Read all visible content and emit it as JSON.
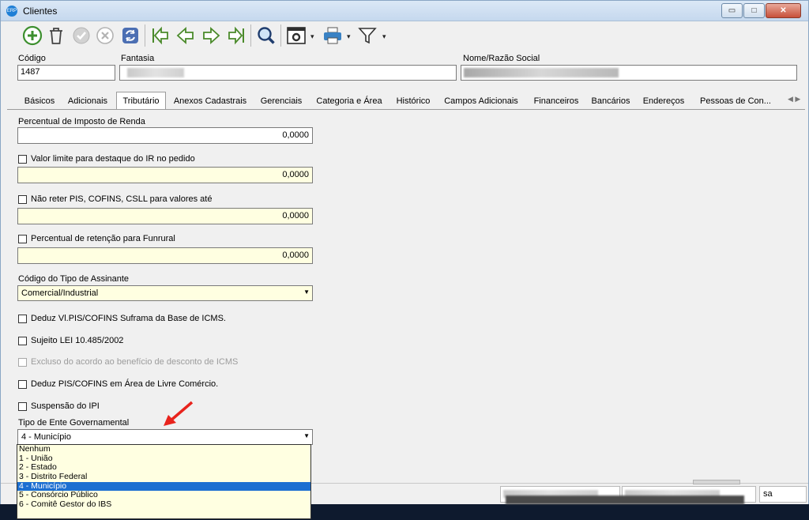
{
  "window": {
    "title": "Clientes",
    "app_icon_text": "ERP",
    "controls": {
      "minimize": "▭",
      "maximize": "□",
      "close": "✕"
    }
  },
  "toolbar": {
    "icons": [
      "add-icon",
      "delete-icon",
      "confirm-icon",
      "cancel-icon",
      "refresh-icon",
      "first-record-icon",
      "previous-record-icon",
      "next-record-icon",
      "last-record-icon",
      "search-icon",
      "settings-icon",
      "print-icon",
      "filter-icon"
    ],
    "dropdown_marker": "▾"
  },
  "header": {
    "codigo_label": "Código",
    "codigo_value": "1487",
    "fantasia_label": "Fantasia",
    "nome_label": "Nome/Razão Social"
  },
  "tabs": {
    "items": [
      "Básicos",
      "Adicionais",
      "Tributário",
      "Anexos Cadastrais",
      "Gerenciais",
      "Categoria e Área",
      "Histórico",
      "Campos Adicionais",
      "Financeiros",
      "Bancários",
      "Endereços",
      "Pessoas de Con..."
    ],
    "active": "Tributário",
    "scroll_arrows": "◀ ▶"
  },
  "tributario": {
    "ir_label": "Percentual de Imposto de Renda",
    "ir_value": "0,0000",
    "limite_ir_label": "Valor limite para destaque do IR no pedido",
    "limite_ir_value": "0,0000",
    "nao_reter_label": "Não reter PIS, COFINS, CSLL para valores até",
    "nao_reter_value": "0,0000",
    "funrural_label": "Percentual de retenção para Funrural",
    "funrural_value": "0,0000",
    "assinante_label": "Código do Tipo de Assinante",
    "assinante_value": "Comercial/Industrial",
    "checkboxes": [
      {
        "label": "Deduz Vl.PIS/COFINS Suframa da Base de ICMS.",
        "disabled": false
      },
      {
        "label": "Sujeito LEI 10.485/2002",
        "disabled": false
      },
      {
        "label": "Excluso do acordo ao benefício de desconto de ICMS",
        "disabled": true
      },
      {
        "label": "Deduz PIS/COFINS em Área de Livre Comércio.",
        "disabled": false
      },
      {
        "label": "Suspensão do IPI",
        "disabled": false
      }
    ],
    "ente_label": "Tipo de Ente Governamental",
    "ente_value": "4 - Município",
    "ente_options": [
      "Nenhum",
      "1 - União",
      "2 - Estado",
      "3 - Distrito Federal",
      "4 - Município",
      "5 - Consórcio Público",
      "6 - Comitê Gestor do IBS"
    ],
    "ente_selected_index": 4
  },
  "statusbar": {
    "right_text": "sa"
  },
  "colors": {
    "selection": "#1c6fd1",
    "readonly_field": "#ffffe1",
    "annotation_arrow": "#e8231c"
  }
}
